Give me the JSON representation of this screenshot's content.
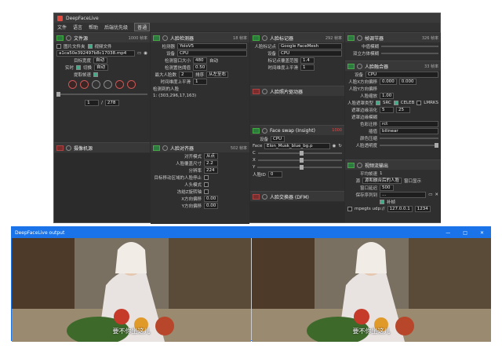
{
  "app": {
    "title": "DeepFaceLive"
  },
  "menu": {
    "file": "文件",
    "language": "语言",
    "help": "帮助",
    "backend_label": "后端优先级",
    "backend_value": "普通"
  },
  "file_source": {
    "title": "文件源",
    "count": "1000 帧率",
    "opt_folder": "图片文件夹",
    "opt_video": "视频文件",
    "filename": "a1ca50e392497b8c17038.mp4",
    "target_width_label": "目标宽度",
    "target_width": "自动",
    "realtime_label": "实时",
    "sync_label": "切换",
    "extract_label": "提取帧速",
    "frame": "1",
    "total": "278"
  },
  "camera": {
    "title": "摄像机源"
  },
  "face_detector": {
    "title": "人脸检测器",
    "fps": "18 帧率",
    "detector_label": "检测器",
    "detector": "YoloV5",
    "device_label": "设备",
    "device": "CPU",
    "window_label": "检测窗口大小",
    "window": "480",
    "auto": "自动",
    "threshold_label": "检测置信阈值",
    "threshold": "0.50",
    "max_faces_label": "最大人脸数",
    "max_faces": "2",
    "sort_label": "排序",
    "sort": "从左至右",
    "temporal_label": "时间维度上平滑",
    "temporal": "1",
    "detected_label": "检测到的人脸",
    "detected_value": "1: (303,296,17,163)"
  },
  "face_aligner": {
    "title": "人脸对齐器",
    "fps": "502 帧率",
    "mode_label": "对齐模式",
    "mode": "从点",
    "coverage_label": "人脸覆盖尺寸",
    "coverage": "2.2",
    "resolution_label": "分辨率",
    "resolution": "224",
    "exclude_label": "目标移动区域的人脸停止",
    "head_mode_label": "人头模式",
    "freeze_label": "冻结Z旋转轴",
    "x_offset_label": "X方向偏移",
    "x_offset": "0.00",
    "y_offset_label": "Y方向偏移",
    "y_offset": "0.00"
  },
  "marker": {
    "title": "人脸标记器",
    "fps": "292 帧率",
    "type_label": "人脸标记点",
    "type": "Google FaceMesh",
    "device_label": "设备",
    "device": "CPU",
    "range_label": "标记点覆盖范围",
    "range": "1.4",
    "temporal_label": "时间维度上平滑",
    "temporal": "1"
  },
  "animator": {
    "title": "人脸照片驱动器"
  },
  "swap_insight": {
    "title": "Face swap (Insight)",
    "fps": "1000",
    "device_label": "设备",
    "device": "CPU",
    "face_label": "Face",
    "face": "Elon_Musk_blue_bg.p",
    "c": "C",
    "x": "X",
    "y": "Y",
    "id_label": "人脸ID",
    "id": "0"
  },
  "swap_dfm": {
    "title": "人脸交换器 (DFM)"
  },
  "frame_adjuster": {
    "title": "帧调节器",
    "fps": "326 帧率",
    "median_label": "中值模糊",
    "degrade_label": "双立方体模糊"
  },
  "merger": {
    "title": "人脸融合器",
    "fps": "33 帧率",
    "device_label": "设备",
    "device": "CPU",
    "x_offset_label": "人脸X方向偏移",
    "x_offset": "0.000",
    "y_offset_label": "人脸Y方向偏移",
    "y_offset": "0.000",
    "scale_label": "人脸缩放",
    "scale": "1.00",
    "mask_label": "人脸遮罩类型",
    "src": "SRC",
    "celeb": "CELEB",
    "lmrks": "LMRKS",
    "erode_label": "遮罩边缘羽化",
    "erode": "5",
    "blur_label": "遮罩边缘模糊",
    "blur": "25",
    "color_label": "色彩迁移",
    "color": "rct",
    "interp_label": "插值",
    "interp": "bilinear",
    "gamma_label": "颜色压缩",
    "opacity_label": "人脸透明度"
  },
  "stream": {
    "title": "视频流输出",
    "avg_label": "平均帧速",
    "avg": "1",
    "source_label": "源",
    "source": "源和融合后的人脸",
    "win_label": "窗口显示",
    "delay_label": "窗口延迟",
    "delay": "500",
    "path_label": "保存序列到",
    "path": "...",
    "mpegts_label": "mpegts udp://",
    "ip": "127.0.0.1",
    "port": "1234",
    "fill_label": "补帧"
  },
  "output": {
    "title": "DeepFaceLive output",
    "subtitle_left": "要不你坐这儿",
    "subtitle_right": "要不你坐这儿"
  }
}
